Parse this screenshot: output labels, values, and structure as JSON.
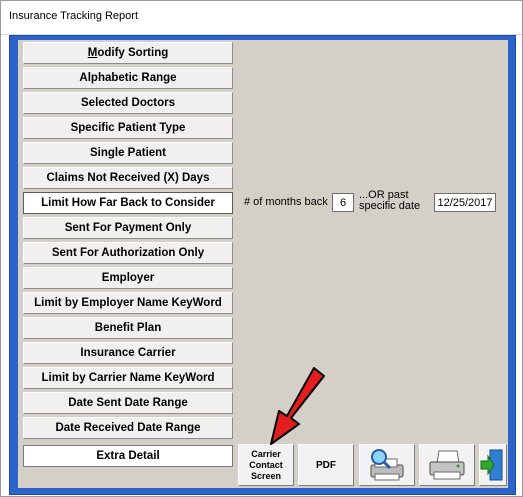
{
  "window": {
    "title": "Insurance Tracking Report"
  },
  "sidebar": {
    "items": [
      {
        "prefix": "",
        "accel": "M",
        "rest": "odify Sorting"
      },
      {
        "prefix": "",
        "accel": "",
        "rest": "Alphabetic Range"
      },
      {
        "prefix": "",
        "accel": "",
        "rest": "Selected Doctors"
      },
      {
        "prefix": "",
        "accel": "",
        "rest": "Specific Patient Type"
      },
      {
        "prefix": "",
        "accel": "",
        "rest": "Single Patient"
      },
      {
        "prefix": "",
        "accel": "",
        "rest": "Claims Not Received (X) Days"
      },
      {
        "prefix": "",
        "accel": "",
        "rest": "Limit How Far Back to Consider"
      },
      {
        "prefix": "",
        "accel": "",
        "rest": "Sent For Payment Only"
      },
      {
        "prefix": "",
        "accel": "",
        "rest": "Sent For Authorization Only"
      },
      {
        "prefix": "",
        "accel": "",
        "rest": "Employer"
      },
      {
        "prefix": "",
        "accel": "",
        "rest": "Limit by Employer Name KeyWord"
      },
      {
        "prefix": "",
        "accel": "",
        "rest": "Benefit Plan"
      },
      {
        "prefix": "",
        "accel": "",
        "rest": "Insurance Carrier"
      },
      {
        "prefix": "",
        "accel": "",
        "rest": "Limit by Carrier Name KeyWord"
      },
      {
        "prefix": "",
        "accel": "",
        "rest": "Date Sent Date Range"
      },
      {
        "prefix": "",
        "accel": "",
        "rest": "Date Received Date Range"
      },
      {
        "prefix": "",
        "accel": "",
        "rest": "Extra Detail"
      }
    ]
  },
  "filter": {
    "months_label": "# of months back",
    "months_value": "6",
    "or_label_line1": "...OR past",
    "or_label_line2": "specific date",
    "date_value": "12/25/2017"
  },
  "toolbar": {
    "carrier_line1": "Carrier",
    "carrier_line2": "Contact",
    "carrier_line3": "Screen",
    "pdf_label": "PDF"
  },
  "icons": {
    "preview": "print-preview-icon",
    "print": "printer-icon",
    "exit": "exit-door-icon",
    "pointer": "red-arrow-icon"
  },
  "colors": {
    "frame_blue": "#2b63c8",
    "panel_gray": "#d4d0c8",
    "arrow_red": "#e41e1e"
  }
}
